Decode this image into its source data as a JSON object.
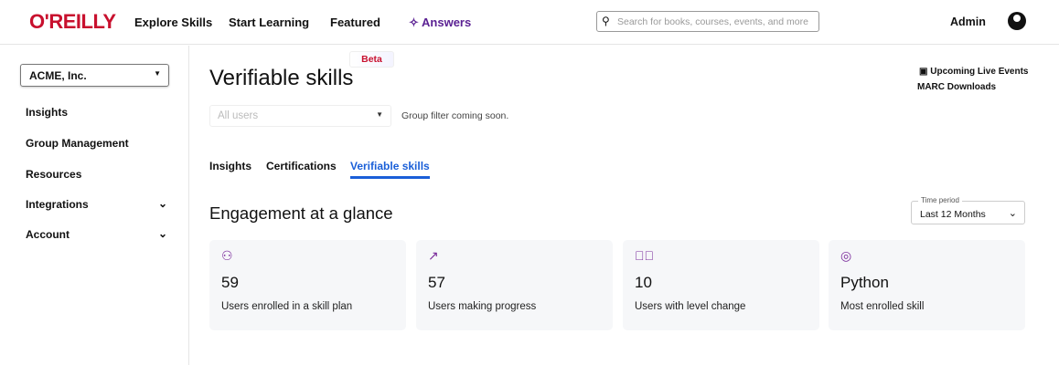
{
  "header": {
    "logo": "O'REILLY",
    "nav": [
      "Explore Skills",
      "Start Learning",
      "Featured",
      "Answers"
    ],
    "search_placeholder": "Search for books, courses, events, and more",
    "admin": "Admin"
  },
  "sidebar": {
    "org": "ACME, Inc.",
    "items": [
      {
        "label": "Insights"
      },
      {
        "label": "Group Management"
      },
      {
        "label": "Resources"
      },
      {
        "label": "Integrations"
      },
      {
        "label": "Account"
      }
    ]
  },
  "main": {
    "title": "Verifiable skills",
    "beta": "Beta",
    "users_placeholder": "All users",
    "group_filter_note": "Group filter coming soon.",
    "tabs": [
      "Insights",
      "Certifications",
      "Verifiable skills"
    ],
    "active_tab": "Verifiable skills",
    "section_title": "Engagement at a glance",
    "time_period_label": "Time period",
    "time_period": "Last 12 Months",
    "links": [
      "Upcoming Live Events",
      "MARC Downloads"
    ],
    "cards": [
      {
        "icon": "users-icon",
        "value": "59",
        "label": "Users enrolled in a skill plan"
      },
      {
        "icon": "trending-up-icon",
        "value": "57",
        "label": "Users making progress"
      },
      {
        "icon": "check-circle-icon",
        "value": "10",
        "label": "Users with level change"
      },
      {
        "icon": "target-icon",
        "value": "Python",
        "label": "Most enrolled skill"
      }
    ]
  },
  "colors": {
    "brand": "#c8102e",
    "accent": "#1a5fd8",
    "purple": "#7a2b9b"
  }
}
